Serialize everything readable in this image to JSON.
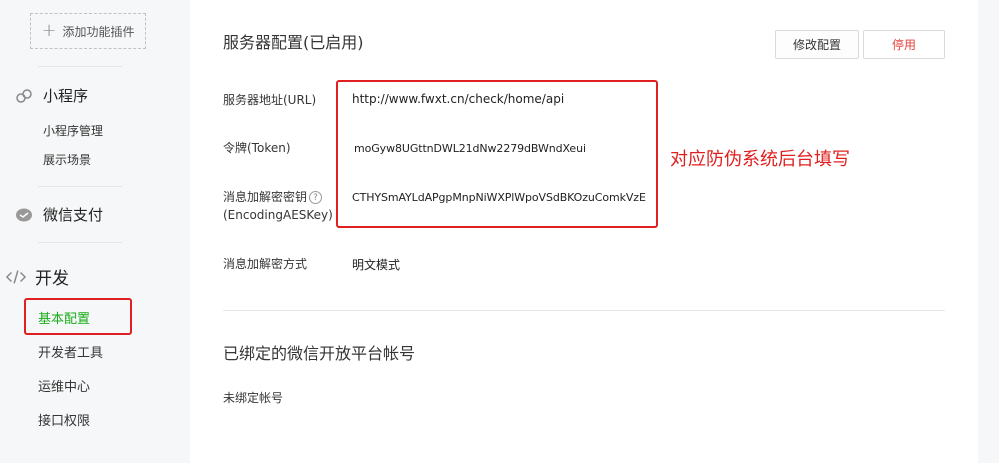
{
  "sidebar": {
    "add_plugin": "添加功能插件",
    "miniprogram": {
      "title": "小程序",
      "items": [
        "小程序管理",
        "展示场景"
      ]
    },
    "wechat_pay": {
      "title": "微信支付"
    },
    "develop": {
      "title": "开发",
      "items": [
        "基本配置",
        "开发者工具",
        "运维中心",
        "接口权限"
      ],
      "active_index": 0
    }
  },
  "server_config": {
    "title": "服务器配置(已启用)",
    "edit_label": "修改配置",
    "stop_label": "停用",
    "fields": {
      "url_label": "服务器地址(URL)",
      "url_value": "http://www.fwxt.cn/check/home/api",
      "token_label": "令牌(Token)",
      "token_value": "moGyw8UGttnDWL21dNw2279dBWndXeui",
      "aeskey_label_1": "消息加解密密钥",
      "aeskey_label_2": "(EncodingAESKey)",
      "aeskey_value": "CTHYSmAYLdAPgpMnpNiWXPlWpoVSdBKOzuComkVzE",
      "mode_label": "消息加解密方式",
      "mode_value": "明文模式"
    },
    "annotation": "对应防伪系统后台填写",
    "help_glyph": "?"
  },
  "open_platform": {
    "title": "已绑定的微信开放平台帐号",
    "status": "未绑定帐号"
  },
  "colors": {
    "accent_green": "#1aad19",
    "highlight_red": "#e02020",
    "stop_red": "#e64340"
  }
}
